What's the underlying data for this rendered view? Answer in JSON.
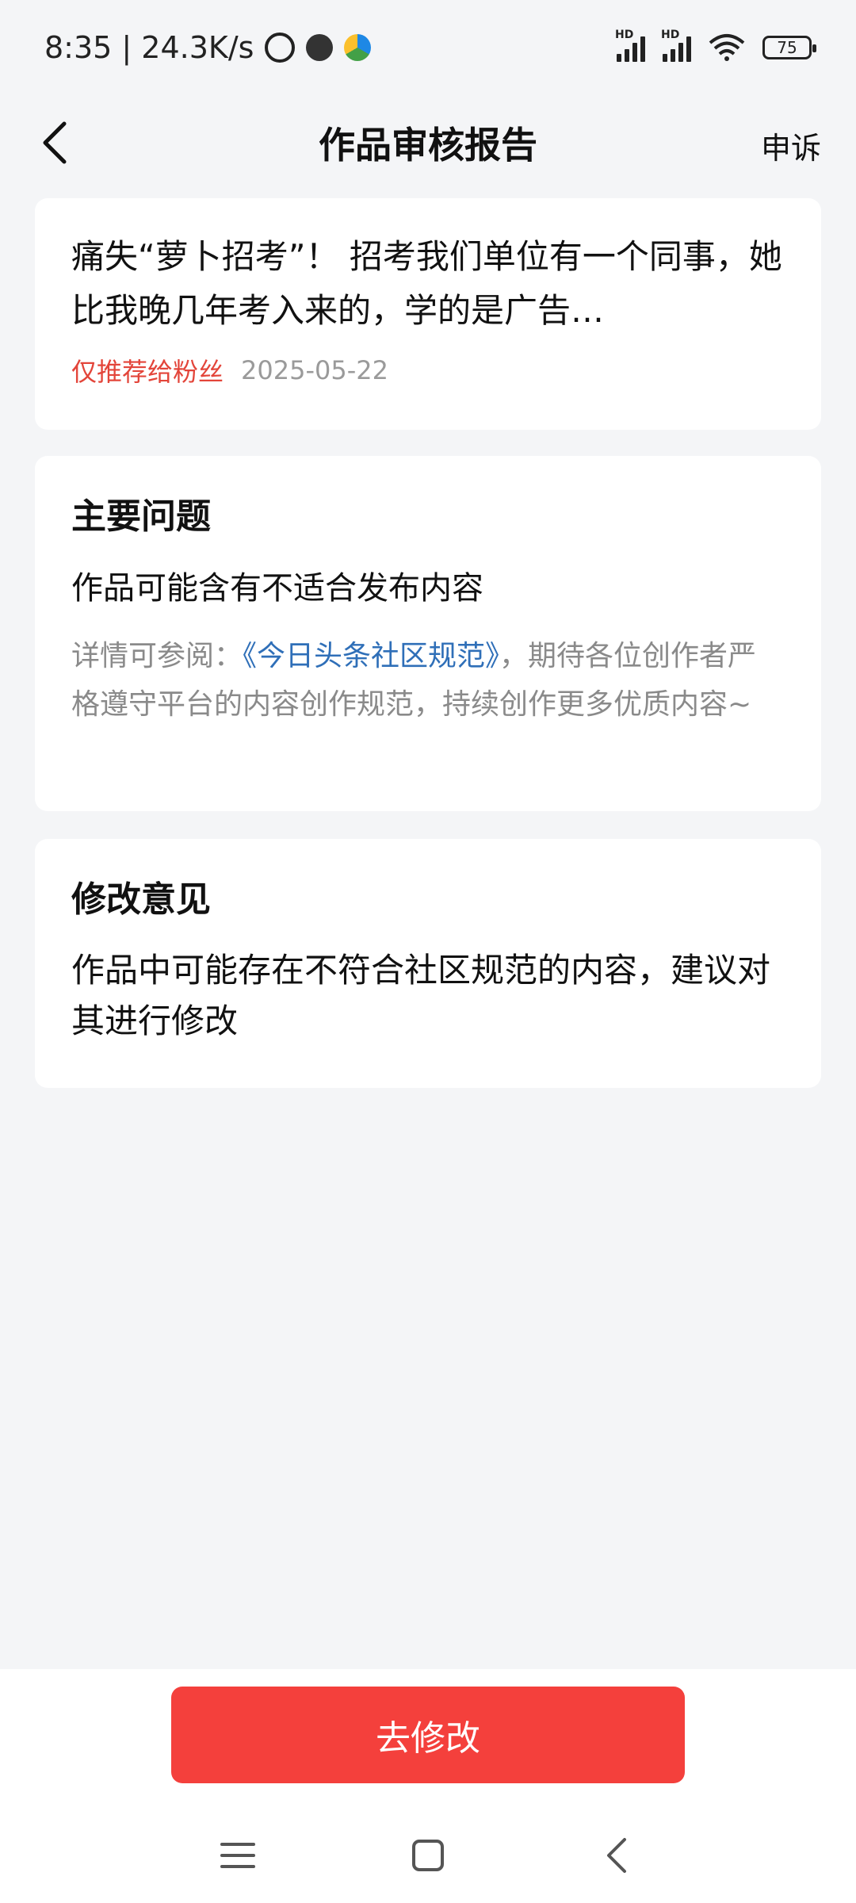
{
  "status_bar": {
    "time_speed": "8:35 | 24.3K/s",
    "hd1": "HD",
    "hd2": "HD",
    "battery": "75"
  },
  "header": {
    "title": "作品审核报告",
    "appeal": "申诉"
  },
  "article": {
    "title": "痛失“萝卜招考”！ 招考我们单位有一个同事，她比我晚几年考入来的，学的是广告…",
    "tag": "仅推荐给粉丝",
    "date": "2025-05-22"
  },
  "issue": {
    "heading": "主要问题",
    "description": "作品可能含有不适合发布内容",
    "detail_prefix": "详情可参阅：",
    "rules_link": "《今日头条社区规范》",
    "detail_suffix": "，期待各位创作者严格遵守平台的内容创作规范，持续创作更多优质内容~"
  },
  "suggestion": {
    "heading": "修改意见",
    "text": "作品中可能存在不符合社区规范的内容，建议对其进行修改"
  },
  "bottom": {
    "edit_button": "去修改"
  },
  "colors": {
    "accent_red": "#f4403c",
    "tag_red": "#e3453a",
    "link_blue": "#2f6fb8",
    "background": "#f4f5f7"
  }
}
